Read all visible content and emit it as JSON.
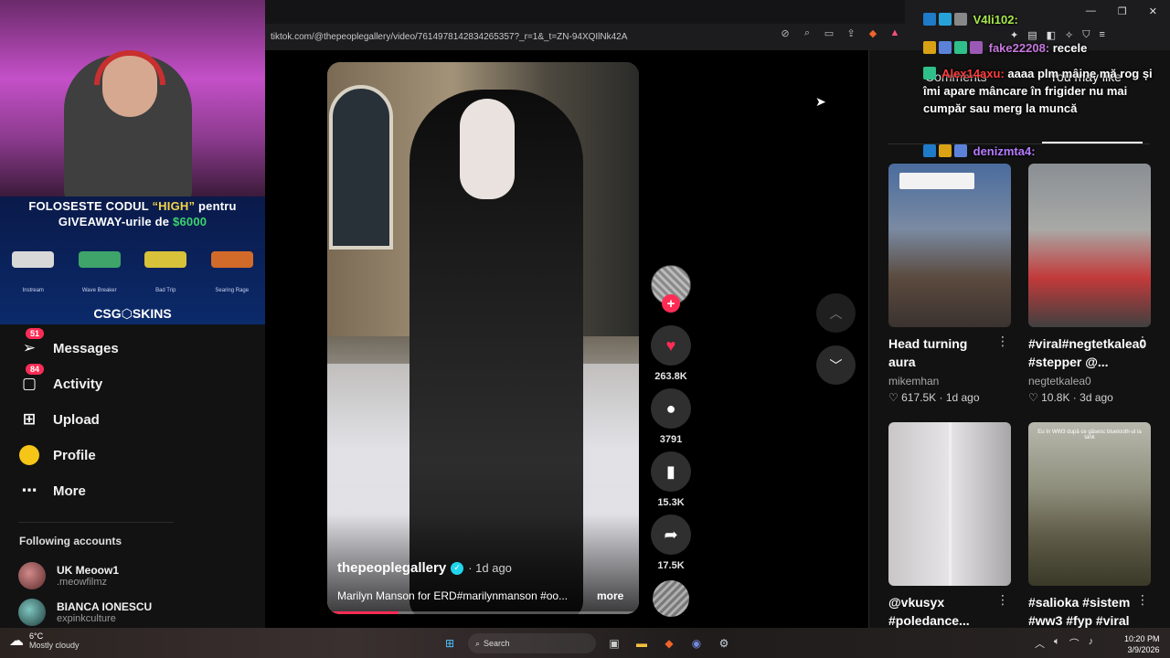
{
  "browser": {
    "url": "tiktok.com/@thepeoplegallery/video/7614978142834265357?_r=1&_t=ZN-94XQIlNk42A"
  },
  "stream_overlay": {
    "promo_line1_prefix": "FOLOSESTE CODUL ",
    "promo_code": "“HIGH”",
    "promo_line1_suffix": " pentru",
    "promo_line2_prefix": "GIVEAWAY-urile de ",
    "promo_amount": "$6000",
    "skins": [
      "Instream",
      "Wave Breaker",
      "Bad Trip",
      "Searing Rage"
    ],
    "brand": "CSG⬡SKINS"
  },
  "sidebar": {
    "items": [
      {
        "label": "Messages",
        "badge": "51",
        "icon": "send-icon"
      },
      {
        "label": "Activity",
        "badge": "84",
        "icon": "activity-icon"
      },
      {
        "label": "Upload",
        "icon": "upload-icon"
      },
      {
        "label": "Profile",
        "icon": "profile-avatar"
      },
      {
        "label": "More",
        "icon": "more-icon"
      }
    ],
    "following_title": "Following accounts",
    "accounts": [
      {
        "name": "UK Meoow1",
        "handle": ".meowfilmz"
      },
      {
        "name": "BIANCA IONESCU",
        "handle": "expinkculture"
      }
    ]
  },
  "video": {
    "author": "thepeoplegallery",
    "time": "· 1d ago",
    "caption": "Marilyn Manson for ERD#marilynmanson #oo...",
    "more": "more",
    "progress": 0.23
  },
  "actions": {
    "likes": "263.8K",
    "comments": "3791",
    "saves": "15.3K",
    "shares": "17.5K"
  },
  "right_pane": {
    "tab_comments": "Comments",
    "tab_you_may_like": "You may like",
    "cards": [
      {
        "title": "Head turning aura",
        "author": "mikemhan",
        "likes": "617.5K",
        "date": "1d ago"
      },
      {
        "title": "#viral#negtetkalea0 #stepper @...",
        "author": "negtetkalea0",
        "likes": "10.8K",
        "date": "3d ago"
      },
      {
        "title": "@vkusyx #poledance...",
        "author": "",
        "likes": "",
        "date": ""
      },
      {
        "title": "#salioka #sistem #ww3 #fyp #viral",
        "author": "",
        "likes": "",
        "date": ""
      }
    ],
    "card4_overlay": "Eu în WW3 după ce găsesc bluetooth-ul la tank"
  },
  "chat": [
    {
      "user": "V4li102:",
      "text": "",
      "color": "#a8e84b"
    },
    {
      "user": "fake22208:",
      "text": "recele",
      "color": "#c678dd"
    },
    {
      "user": "Alex14axu:",
      "text": "aaaa plm mâine mă rog și îmi apare mâncare în frigider nu mai cumpăr sau merg la muncă",
      "color": "#ff3b3b"
    },
    {
      "user": "denizmta4:",
      "text": "",
      "color": "#b77bff"
    }
  ],
  "taskbar": {
    "temp": "6°C",
    "condition": "Mostly cloudy",
    "search": "Search",
    "time": "10:20 PM",
    "date": "3/9/2026"
  },
  "colors": {
    "accent": "#fe2c55",
    "verified": "#20d5ec"
  }
}
